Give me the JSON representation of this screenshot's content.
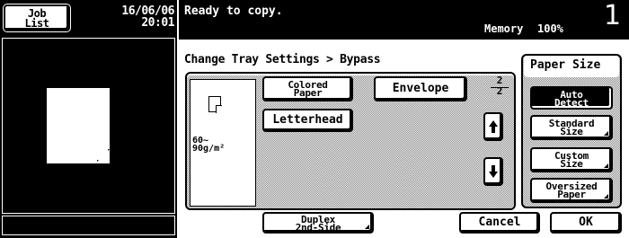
{
  "sidebar": {
    "job_list_line1": "Job",
    "job_list_line2": "List",
    "date": "16/06/06",
    "time": "20:01"
  },
  "status": {
    "message": "Ready to copy.",
    "memory_label": "Memory",
    "memory_value": "100%",
    "copy_count": "1"
  },
  "main": {
    "breadcrumb": "Change Tray Settings > Bypass",
    "paper_weight_line1": "60~",
    "paper_weight_line2": "90g/m²",
    "paper_types": {
      "colored_line1": "Colored",
      "colored_line2": "Paper",
      "envelope": "Envelope",
      "letterhead": "Letterhead"
    },
    "page_current": "2",
    "page_total": "2"
  },
  "paper_size": {
    "title": "Paper Size",
    "auto_line1": "Auto",
    "auto_line2": "Detect",
    "standard_line1": "Standard",
    "standard_line2": "Size",
    "custom_line1": "Custom",
    "custom_line2": "Size",
    "oversized_line1": "Oversized",
    "oversized_line2": "Paper"
  },
  "footer": {
    "duplex_line1": "Duplex",
    "duplex_line2": "2nd-Side",
    "cancel": "Cancel",
    "ok": "OK"
  }
}
